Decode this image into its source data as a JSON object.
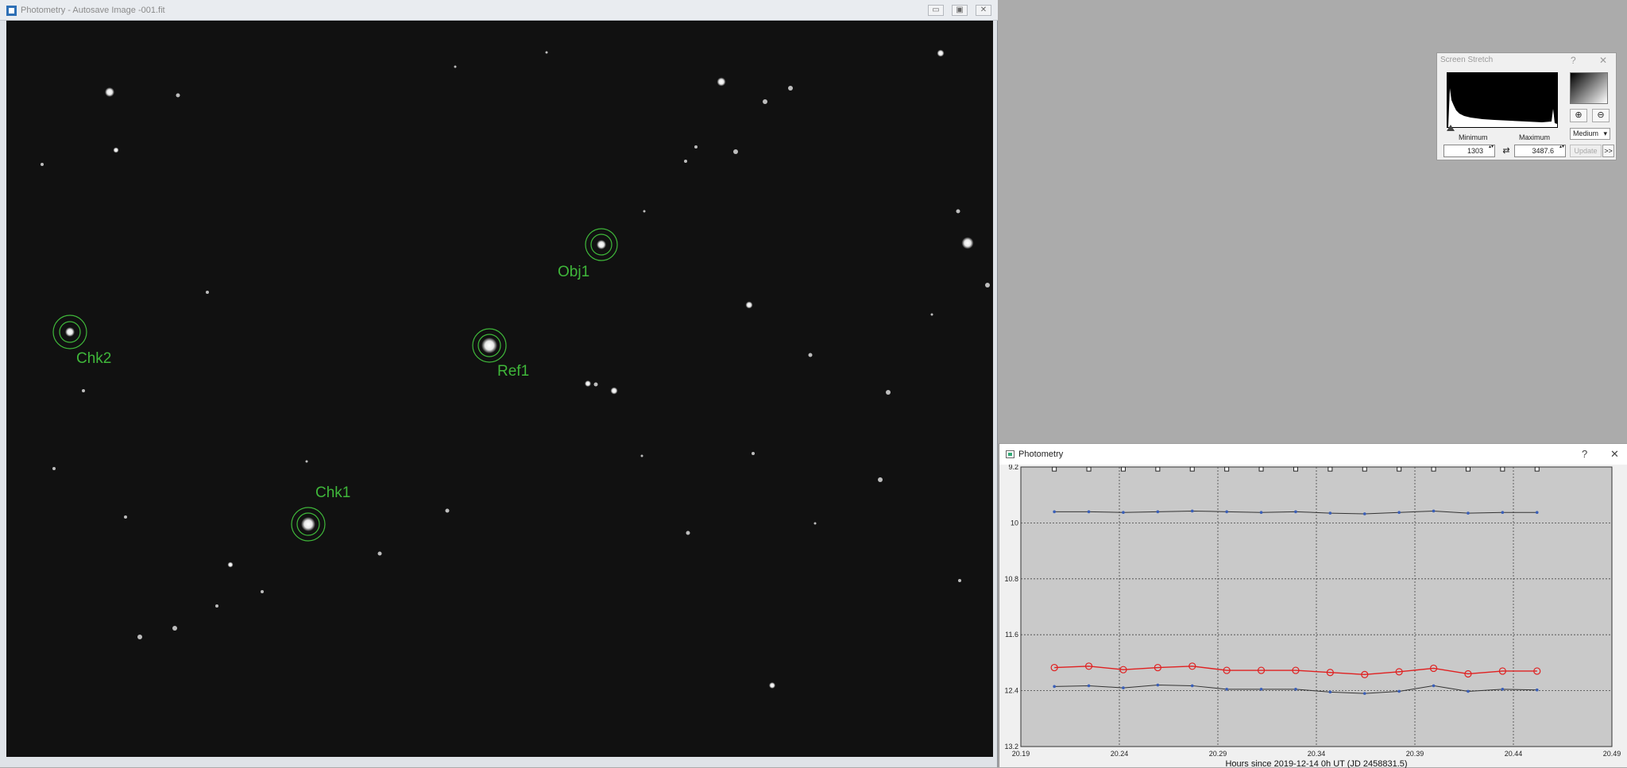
{
  "image_window": {
    "title": "Photometry - Autosave Image -001.fit",
    "controls": {
      "minimize": "▭",
      "restore": "▣",
      "close": "✕"
    },
    "apertures": [
      {
        "label": "Obj1",
        "kind": "object"
      },
      {
        "label": "Ref1",
        "kind": "reference"
      },
      {
        "label": "Chk1",
        "kind": "check"
      },
      {
        "label": "Chk2",
        "kind": "check"
      }
    ],
    "colors": {
      "sky": "#111111",
      "aperture": "#3fb73a"
    }
  },
  "screen_stretch": {
    "title": "Screen Stretch",
    "help": "?",
    "close": "✕",
    "zoom_in": "⊕",
    "zoom_out": "⊖",
    "minimum_label": "Minimum",
    "maximum_label": "Maximum",
    "minimum_value": "1303",
    "maximum_value": "3487.6",
    "swap": "⇄",
    "mode": "Medium",
    "update_label": "Update",
    "more_label": ">>"
  },
  "photometry_window": {
    "title": "Photometry",
    "help": "?",
    "close": "✕",
    "chart_data": {
      "type": "line",
      "xlabel": "Hours since 2019-12-14 0h UT (JD 2458831.5)",
      "ylabel": "",
      "x_ticks": [
        "20.19",
        "20.24",
        "20.29",
        "20.34",
        "20.39",
        "20.44",
        "20.49"
      ],
      "y_ticks": [
        "9.2",
        "10",
        "10.8",
        "11.6",
        "12.4",
        "13.2"
      ],
      "xlim": [
        20.19,
        20.49
      ],
      "ylim": [
        9.2,
        13.2
      ],
      "y_inverted": true,
      "grid": true,
      "x": [
        20.207,
        20.2245,
        20.242,
        20.2595,
        20.277,
        20.2945,
        20.312,
        20.3295,
        20.347,
        20.3645,
        20.382,
        20.3995,
        20.417,
        20.4345,
        20.452
      ],
      "series": [
        {
          "marker": "square",
          "color": "#222222",
          "values": [
            9.23,
            9.23,
            9.23,
            9.23,
            9.23,
            9.23,
            9.23,
            9.23,
            9.23,
            9.23,
            9.23,
            9.23,
            9.23,
            9.23,
            9.23
          ]
        },
        {
          "marker": "dot",
          "color": "#3a5fb8",
          "line_color": "#333333",
          "values": [
            9.84,
            9.84,
            9.85,
            9.84,
            9.83,
            9.84,
            9.85,
            9.84,
            9.86,
            9.87,
            9.85,
            9.83,
            9.86,
            9.85,
            9.85
          ]
        },
        {
          "marker": "circle",
          "color": "#e02020",
          "values": [
            12.07,
            12.05,
            12.1,
            12.07,
            12.05,
            12.11,
            12.11,
            12.11,
            12.14,
            12.17,
            12.13,
            12.08,
            12.16,
            12.12,
            12.12
          ]
        },
        {
          "marker": "dot",
          "color": "#3a5fb8",
          "line_color": "#333333",
          "values": [
            12.34,
            12.33,
            12.36,
            12.32,
            12.33,
            12.38,
            12.38,
            12.38,
            12.42,
            12.44,
            12.41,
            12.33,
            12.41,
            12.38,
            12.39
          ]
        }
      ]
    }
  }
}
